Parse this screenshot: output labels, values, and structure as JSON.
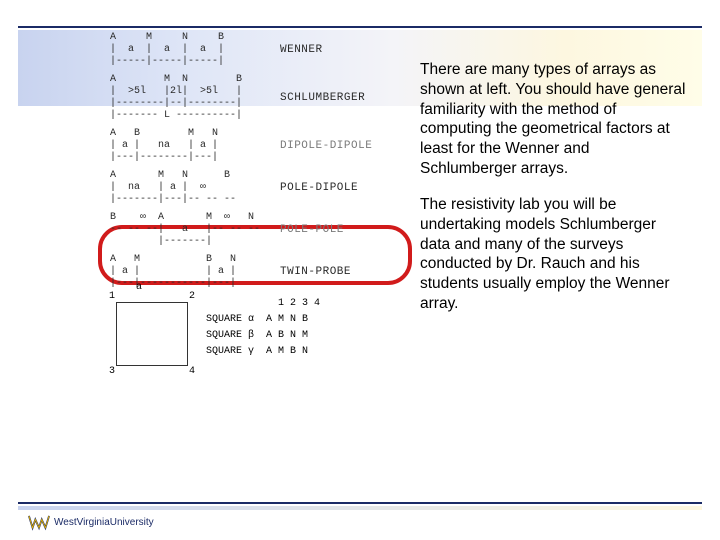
{
  "paragraphs": {
    "p1": "There are many types of arrays as shown at left. You should have general familiarity with the method of computing the geometrical factors at least for the Wenner and Schlumberger arrays.",
    "p2": "The resistivity lab you will be undertaking models Schlumberger data and many of the surveys conducted by Dr. Rauch and his students usually employ the Wenner array."
  },
  "arrays": [
    {
      "name": "WENNER",
      "faint": false,
      "schematic": "A     M     N     B\n|  a  |  a  |  a  |\n|-----|-----|-----|"
    },
    {
      "name": "SCHLUMBERGER",
      "faint": false,
      "schematic": "A        M  N        B\n|  >5l   |2l|  >5l   |\n|--------|--|--------|\n|------- L ----------|"
    },
    {
      "name": "DIPOLE-DIPOLE",
      "faint": true,
      "schematic": "A   B        M   N\n| a |   na   | a |\n|---|--------|---|"
    },
    {
      "name": "POLE-DIPOLE",
      "faint": false,
      "schematic": "A       M   N      B\n|  na   | a |  ∞   \n|-------|---|-- -- --"
    },
    {
      "name": "POLE-POLE",
      "faint": true,
      "schematic": "B    ∞  A       M  ∞   N\n-- -- --|   a   |-- -- --\n        |-------|"
    },
    {
      "name": "TWIN-PROBE",
      "faint": false,
      "schematic": "A   M           B   N\n| a |           | a |\n|---|-----------|---|"
    }
  ],
  "square": {
    "a_label": "a",
    "corners": {
      "c1": "1",
      "c2": "2",
      "c3": "3",
      "c4": "4"
    },
    "header": "1 2 3 4",
    "rows": [
      {
        "name": "SQUARE α",
        "order": "A M N B"
      },
      {
        "name": "SQUARE β",
        "order": "A B N M"
      },
      {
        "name": "SQUARE γ",
        "order": "A M B N"
      }
    ]
  },
  "footer": {
    "university": "WestVirginiaUniversity"
  }
}
